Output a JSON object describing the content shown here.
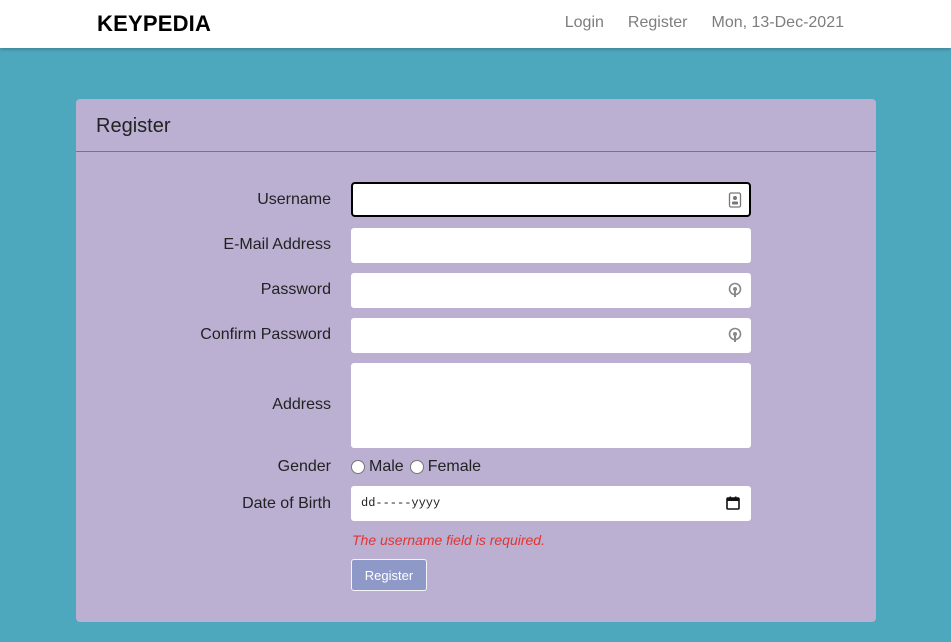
{
  "navbar": {
    "brand": "KEYPEDIA",
    "links": [
      "Login",
      "Register"
    ],
    "date": "Mon, 13-Dec-2021"
  },
  "card": {
    "title": "Register"
  },
  "form": {
    "username_label": "Username",
    "email_label": "E-Mail Address",
    "password_label": "Password",
    "confirm_password_label": "Confirm Password",
    "address_label": "Address",
    "gender_label": "Gender",
    "gender_options": [
      "Male",
      "Female"
    ],
    "dob_label": "Date of Birth",
    "dob_placeholder": "dd-----yyyy",
    "error": "The username field is required.",
    "submit_label": "Register"
  },
  "colors": {
    "page_bg": "#4ea8bd",
    "card_bg": "#bbafd2",
    "button_bg": "#8f99c8",
    "error": "#e3342f"
  },
  "icons": [
    "contact-card-icon",
    "password-key-icon",
    "calendar-icon"
  ]
}
